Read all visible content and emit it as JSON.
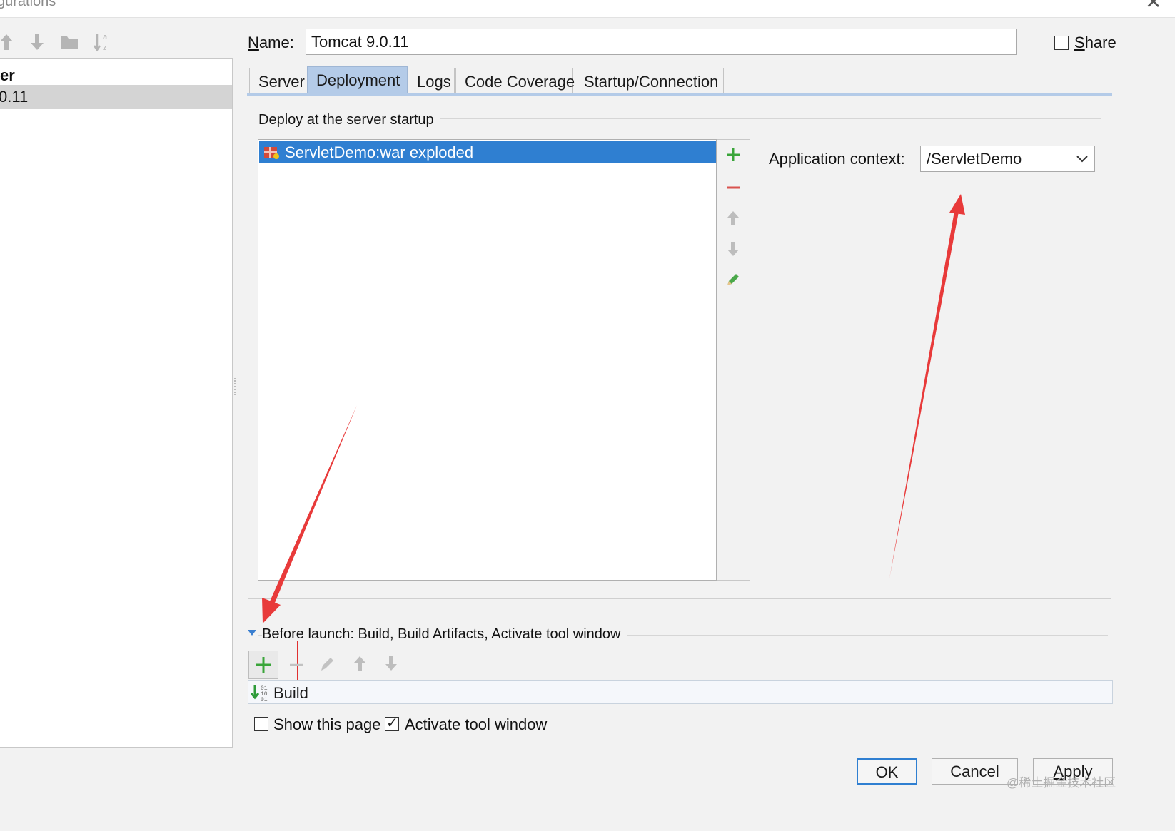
{
  "window": {
    "title": "gurations",
    "close_glyph": "✕"
  },
  "left_panel": {
    "toolbar": [
      "arrow-up-icon",
      "arrow-down-icon",
      "folder-icon",
      "sort-alpha-icon"
    ],
    "tree_header": "er",
    "selected_item": "0.11"
  },
  "name_row": {
    "label": "Name:",
    "value": "Tomcat 9.0.11",
    "share_label": "Share",
    "share_checked": false
  },
  "tabs": [
    {
      "label": "Server",
      "active": false
    },
    {
      "label": "Deployment",
      "active": true
    },
    {
      "label": "Logs",
      "active": false
    },
    {
      "label": "Code Coverage",
      "active": false
    },
    {
      "label": "Startup/Connection",
      "active": false
    }
  ],
  "deployment": {
    "group_title": "Deploy at the server startup",
    "items": [
      {
        "label": "ServletDemo:war exploded",
        "icon": "artifact-icon",
        "selected": true
      }
    ],
    "side_tools": [
      "add-icon",
      "remove-icon",
      "move-up-icon",
      "move-down-icon",
      "edit-icon"
    ],
    "app_context_label": "Application context:",
    "app_context_value": "/ServletDemo"
  },
  "before_launch": {
    "title": "Before launch: Build, Build Artifacts, Activate tool window",
    "toolbar": [
      "add-icon",
      "remove-icon",
      "edit-icon",
      "move-up-icon",
      "move-down-icon"
    ],
    "items": [
      {
        "label": "Build",
        "icon": "build-icon"
      }
    ],
    "show_page_label": "Show this page",
    "show_page_checked": false,
    "activate_label": "Activate tool window",
    "activate_checked": true
  },
  "buttons": {
    "ok": "OK",
    "cancel": "Cancel",
    "apply": "Apply"
  },
  "watermark": "@稀土掘金技术社区",
  "colors": {
    "accent": "#2f7fd1",
    "tab_active": "#b4cbe8",
    "annotation": "#e83a3a",
    "add_green": "#3aa53a",
    "remove_red": "#d9534f"
  }
}
